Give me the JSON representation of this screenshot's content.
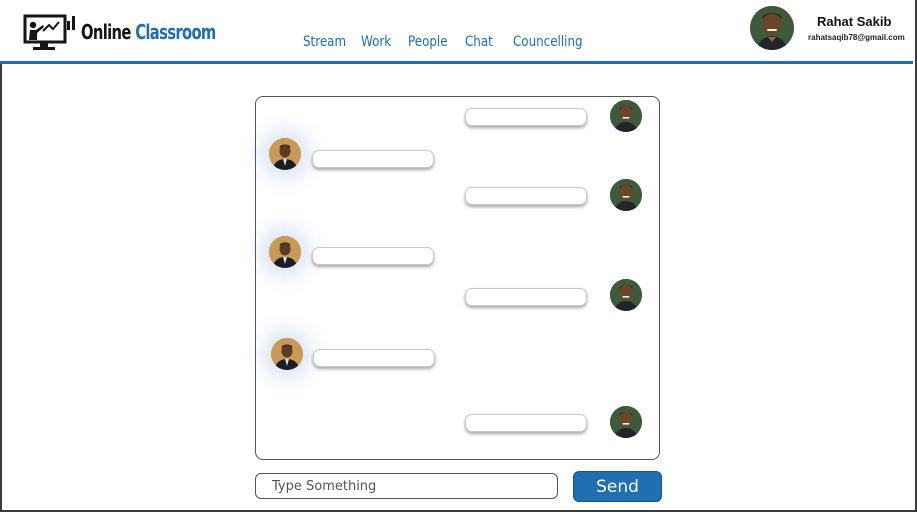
{
  "app": {
    "logo_part1": "Online",
    "logo_part2": "Classroom",
    "logo_icon": "teacher-at-board-icon"
  },
  "nav": {
    "items": [
      {
        "label": "Stream"
      },
      {
        "label": "Work"
      },
      {
        "label": "People"
      },
      {
        "label": "Chat"
      },
      {
        "label": "Councelling"
      }
    ]
  },
  "profile": {
    "name": "Rahat Sakib",
    "email": "rahatsaqib78@gmail.com"
  },
  "chat": {
    "messages": [
      {
        "sender": "student",
        "text": ""
      },
      {
        "sender": "teacher",
        "text": ""
      },
      {
        "sender": "student",
        "text": ""
      },
      {
        "sender": "teacher",
        "text": ""
      },
      {
        "sender": "student",
        "text": ""
      },
      {
        "sender": "teacher",
        "text": ""
      },
      {
        "sender": "student",
        "text": ""
      }
    ]
  },
  "composer": {
    "placeholder": "Type Something",
    "send_label": "Send"
  },
  "colors": {
    "accent": "#1f6fb2",
    "border": "#555555"
  }
}
